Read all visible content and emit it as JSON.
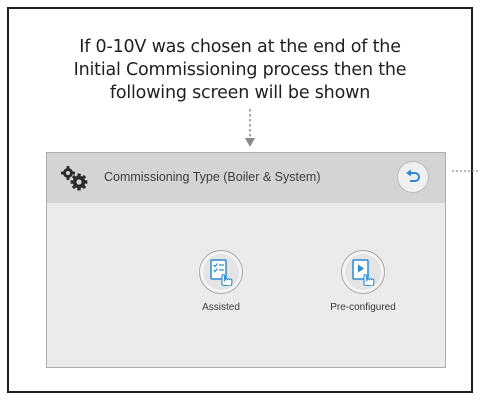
{
  "caption": {
    "line1": "If 0-10V was chosen at the end of the",
    "line2": "Initial Commissioning process then the",
    "line3": "following screen will be shown"
  },
  "screen": {
    "header": {
      "title": "Commissioning Type (Boiler & System)",
      "settings_icon": "gears-icon",
      "back_icon": "back-arrow-icon"
    },
    "options": [
      {
        "label": "Assisted",
        "icon": "checklist-touch-icon"
      },
      {
        "label": "Pre-configured",
        "icon": "play-touch-icon"
      }
    ]
  },
  "colors": {
    "accent_blue": "#2b8ad0",
    "header_bg": "#d4d4d4",
    "screen_bg": "#ebebeb",
    "text": "#3d3d3d"
  }
}
